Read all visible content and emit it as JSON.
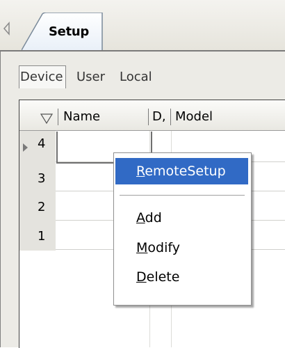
{
  "tabs": [
    {
      "label": "Setup",
      "active": true
    }
  ],
  "subtabs": [
    {
      "label": "Device",
      "active": true
    },
    {
      "label": "User"
    },
    {
      "label": "Local"
    }
  ],
  "grid": {
    "columns": [
      "Name",
      "D,",
      "Model"
    ],
    "rows": [
      "4",
      "3",
      "2",
      "1"
    ],
    "selected_row": "4"
  },
  "context_menu": {
    "items": [
      {
        "label": "RemoteSetup",
        "mnemonic": "R",
        "highlighted": true
      },
      {
        "label": "Add",
        "mnemonic": "A"
      },
      {
        "label": "Modify",
        "mnemonic": "M"
      },
      {
        "label": "Delete",
        "mnemonic": "D"
      }
    ]
  },
  "colors": {
    "highlight": "#316ac5",
    "panel": "#ecebe6"
  }
}
